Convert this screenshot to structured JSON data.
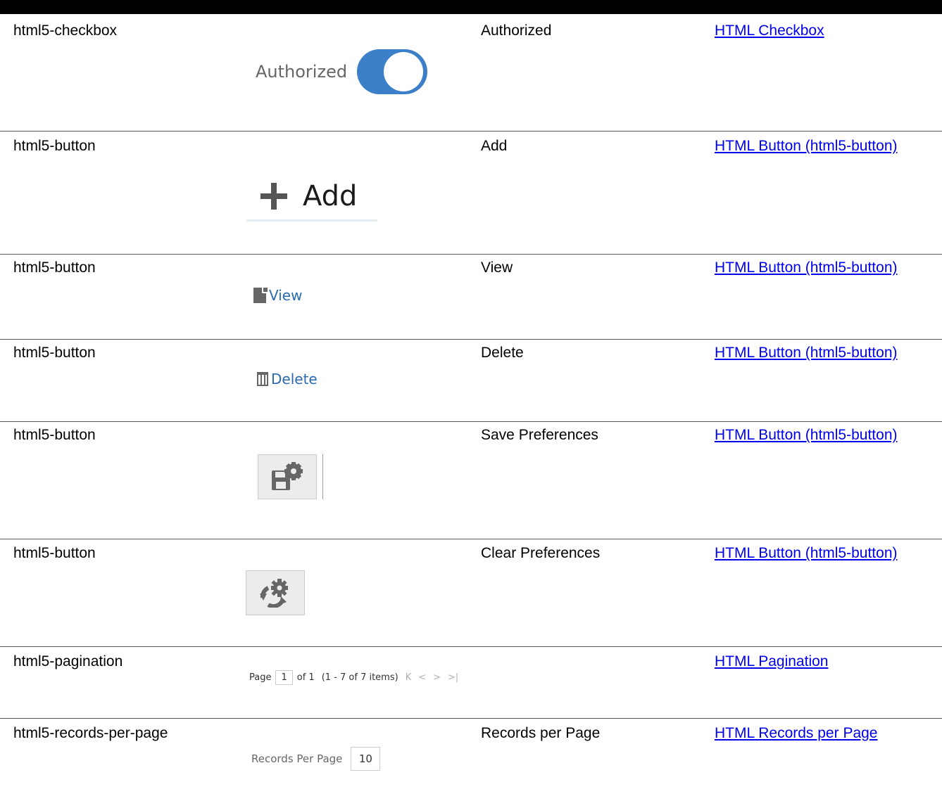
{
  "rows": [
    {
      "type": "html5-checkbox",
      "label": "Authorized",
      "link": "HTML Checkbox",
      "shot_text": "Authorized"
    },
    {
      "type": "html5-button",
      "label": "Add",
      "link": "HTML Button (html5-button)",
      "shot_text": "Add"
    },
    {
      "type": "html5-button",
      "label": "View",
      "link": "HTML Button (html5-button)",
      "shot_text": "View"
    },
    {
      "type": "html5-button",
      "label": "Delete",
      "link": "HTML Button (html5-button)",
      "shot_text": "Delete"
    },
    {
      "type": "html5-button",
      "label": "Save Preferences",
      "link": "HTML Button (html5-button)"
    },
    {
      "type": "html5-button",
      "label": "Clear Preferences",
      "link": "HTML Button (html5-button)"
    },
    {
      "type": "html5-pagination",
      "label": "",
      "link": "HTML Pagination"
    },
    {
      "type": "html5-records-per-page",
      "label": "Records per Page",
      "link": "HTML Records per Page",
      "shot_text": "Records Per Page",
      "value": "10"
    }
  ],
  "pagination": {
    "page_label": "Page",
    "page_value": "1",
    "of_text": "of 1",
    "range_text": "(1 - 7 of  7  items)",
    "first": "K",
    "prev": "<",
    "next": ">",
    "last": ">|"
  },
  "icons": {
    "toggle": "toggle-on",
    "add": "plus-icon",
    "view": "document-icon",
    "delete": "trash-icon",
    "save_prefs": "save-gear-icon",
    "clear_prefs": "refresh-gear-icon"
  },
  "colors": {
    "link": "#0000ee",
    "toggle_on": "#3a7fc8",
    "button_text": "#2a6ab0"
  }
}
